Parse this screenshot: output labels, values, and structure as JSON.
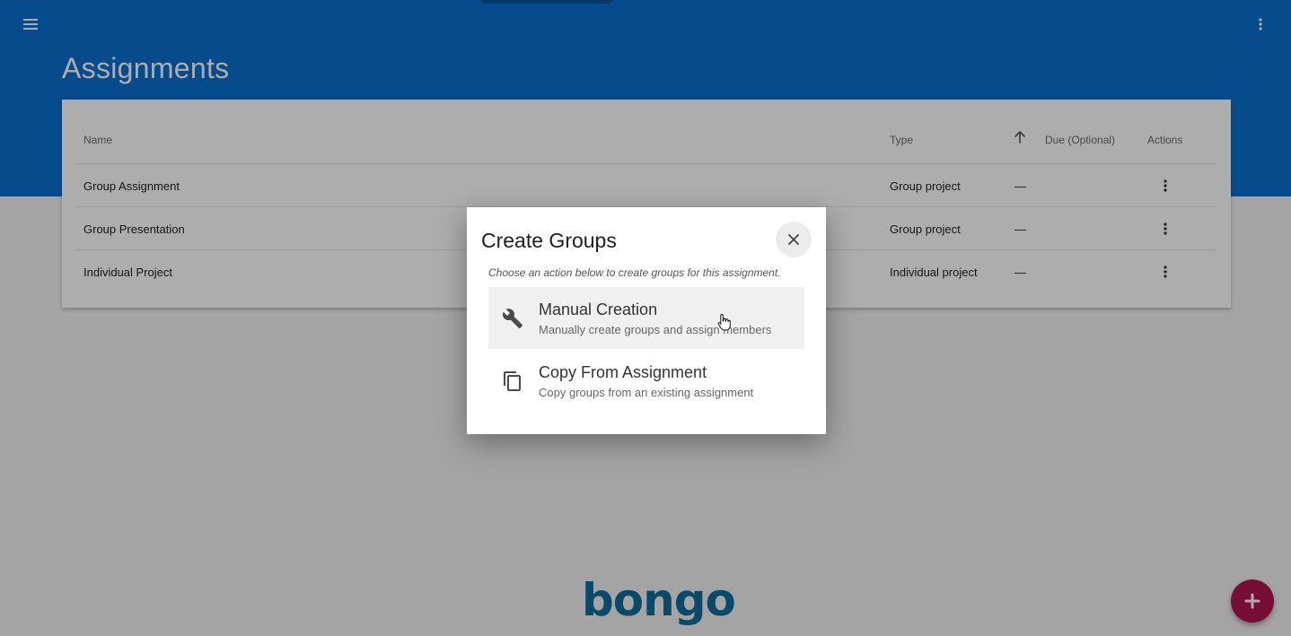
{
  "header": {
    "title": "Assignments",
    "background_color": "#0a6fce",
    "menu_icon": "hamburger-menu-icon",
    "more_icon": "more-vert-icon"
  },
  "table": {
    "headers": {
      "name": "Name",
      "type": "Type",
      "due": "Due (Optional)",
      "actions": "Actions"
    },
    "sort_icon": "arrow-upward-icon",
    "rows": [
      {
        "name": "Group Assignment",
        "type": "Group project",
        "due": "—"
      },
      {
        "name": "Group Presentation",
        "type": "Group project",
        "due": "—"
      },
      {
        "name": "Individual Project",
        "type": "Individual project",
        "due": "—"
      }
    ]
  },
  "dialog": {
    "title": "Create Groups",
    "subtitle": "Choose an action below to create groups for this assignment.",
    "close_icon": "close-icon",
    "options": [
      {
        "icon": "wrench-icon",
        "title": "Manual Creation",
        "description": "Manually create groups and assign members"
      },
      {
        "icon": "copy-icon",
        "title": "Copy From Assignment",
        "description": "Copy groups from an existing assignment"
      }
    ]
  },
  "footer": {
    "logo_text": "bongo",
    "logo_color": "#0c6d9a"
  },
  "fab": {
    "icon": "plus-icon",
    "color": "#b0134f"
  }
}
